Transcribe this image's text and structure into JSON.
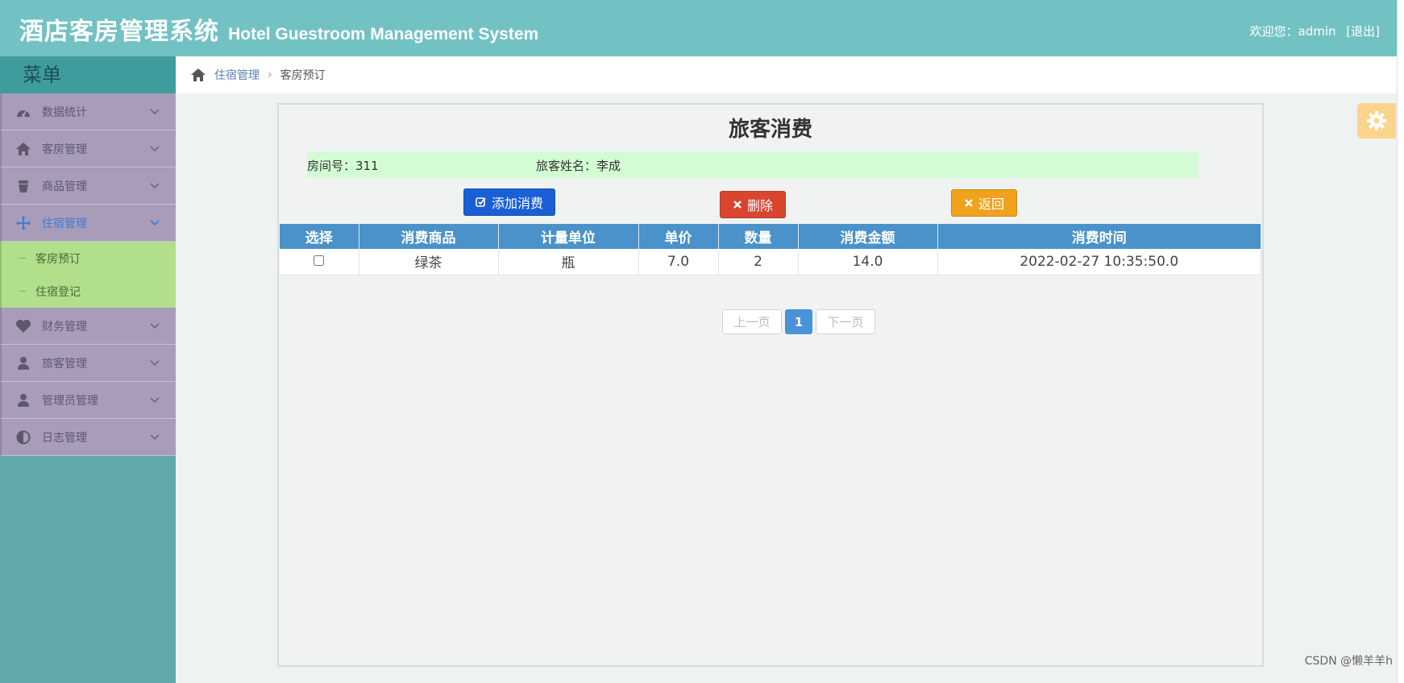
{
  "header": {
    "title_cn": "酒店客房管理系统",
    "title_en": "Hotel Guestroom Management System",
    "welcome": "欢迎您：admin",
    "logout": "[退出]"
  },
  "sidebar": {
    "title": "菜单",
    "items": [
      {
        "label": "数据统计",
        "icon": "dashboard-icon"
      },
      {
        "label": "客房管理",
        "icon": "home-icon"
      },
      {
        "label": "商品管理",
        "icon": "cup-icon"
      },
      {
        "label": "住宿管理",
        "icon": "move-icon",
        "active": true
      },
      {
        "label": "财务管理",
        "icon": "heart-icon"
      },
      {
        "label": "旅客管理",
        "icon": "user-icon"
      },
      {
        "label": "管理员管理",
        "icon": "user-icon"
      },
      {
        "label": "日志管理",
        "icon": "contrast-icon"
      }
    ],
    "subitems": [
      "客房预订",
      "住宿登记"
    ]
  },
  "breadcrumb": {
    "parent": "住宿管理",
    "current": "客房预订"
  },
  "panel": {
    "title": "旅客消费",
    "room_label": "房间号：311",
    "guest_label": "旅客姓名：李成"
  },
  "buttons": {
    "add": "添加消费",
    "delete": "删除",
    "back": "返回"
  },
  "colors": {
    "header": "#72c2c4",
    "sidebar": "#5fa9a8",
    "menu_item": "#a89cb9",
    "sub_item": "#b2df8a",
    "table_header": "#4a92c9",
    "btn_add": "#1a5fd6",
    "btn_delete": "#d9452f",
    "btn_back": "#f0a21e"
  },
  "table": {
    "columns": [
      "选择",
      "消费商品",
      "计量单位",
      "单价",
      "数量",
      "消费金额",
      "消费时间"
    ],
    "rows": [
      {
        "product": "绿茶",
        "unit": "瓶",
        "price": "7.0",
        "qty": "2",
        "amount": "14.0",
        "time": "2022-02-27 10:35:50.0"
      }
    ]
  },
  "pagination": {
    "prev": "上一页",
    "current": "1",
    "next": "下一页"
  },
  "watermark": "CSDN @懒羊羊h"
}
